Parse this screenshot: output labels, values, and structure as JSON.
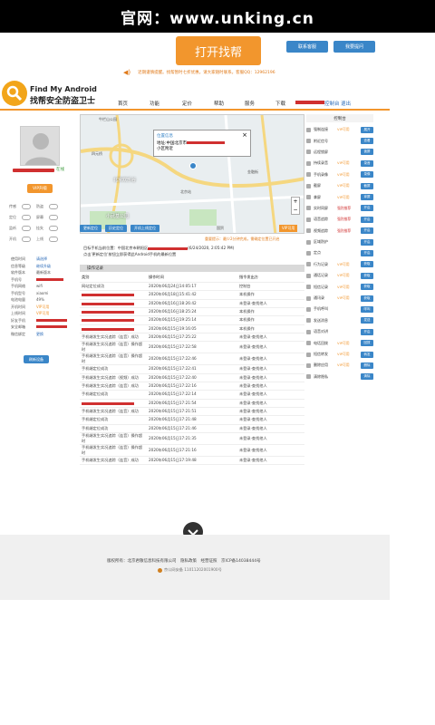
{
  "topbar": {
    "text": "官网：www.unking.cn"
  },
  "banner": {
    "open_label": "打开找帮",
    "cust_label": "联系客服",
    "ask_label": "我要提问",
    "notice": "近期谨慎提醒。找帮暂时七折优惠。请大家随时联系。客服QQ：12962196"
  },
  "brand": {
    "title_en": "Find My Android",
    "title_cn": "找帮安全防盗卫士"
  },
  "nav": {
    "items": [
      "首页",
      "功能",
      "定价",
      "帮助",
      "服务",
      "下载"
    ],
    "user_suffix": "控制台",
    "logout": "退出"
  },
  "user": {
    "status": "在线",
    "vip_label": "VIP升级"
  },
  "toggles": [
    {
      "a": "传感",
      "b": "防盗"
    },
    {
      "a": "定位",
      "b": "屏幕"
    },
    {
      "a": "监听",
      "b": "挂失"
    },
    {
      "a": "开机",
      "b": "上线"
    }
  ],
  "info": [
    {
      "k": "使用时间",
      "v": "请选择"
    },
    {
      "k": "信息等级",
      "v": "继续升级"
    },
    {
      "k": "软件版本",
      "v": "最新版本"
    },
    {
      "k": "手机号",
      "v": ""
    },
    {
      "k": "手机网络",
      "v": "wifi"
    },
    {
      "k": "手机型号",
      "v": "xiaomi"
    },
    {
      "k": "电池电量",
      "v": "49%"
    },
    {
      "k": "开机时间",
      "v": "VIP可用"
    },
    {
      "k": "上线时间",
      "v": "VIP可用"
    },
    {
      "k": "好友手机",
      "v": ""
    },
    {
      "k": "安全邮箱",
      "v": ""
    },
    {
      "k": "微信绑定",
      "v": "更换"
    }
  ],
  "detail_label": "刷新设备",
  "map": {
    "popup_title": "位置信息",
    "popup_addr": "地址:中国北京市",
    "popup_sub": "小区附近",
    "labels": [
      "牛栏山公园",
      "四元桥",
      "北京欢乐谷",
      "北京站",
      "小武基公园",
      "金融街",
      "国贸"
    ],
    "btns": [
      "更新定位",
      "历史定位",
      "开机上线定位"
    ],
    "vip_btn": "VIP可用",
    "tag": "重要提示：最少2分钟完成，需确定位置已开启",
    "loc_line1": "目标手机当前位置：中国北京市朝阳区",
    "loc_time": "(6/24/2020, 2:05:42 PM)",
    "loc_line2": "点击'更新定位'按钮立即获得此Android手机的最新位置"
  },
  "table": {
    "title": "操作记录",
    "headers": [
      "类别",
      "操作时间",
      "指令发出方"
    ],
    "rows": [
      [
        "网站定位成功",
        "2020年06月24日14:05:17",
        "控制台"
      ],
      [
        "",
        "2020年06月18日15:41:42",
        "本机操作"
      ],
      [
        "",
        "2020年06月16日18:26:42",
        "未登录·查找他人"
      ],
      [
        "",
        "2020年06月16日18:25:24",
        "本机操作"
      ],
      [
        "",
        "2020年06月15日19:25:14",
        "本机操作"
      ],
      [
        "",
        "2020年06月15日19:16:05",
        "本机操作"
      ],
      [
        "手机端发生实况追踪（连音）成功",
        "2020年06月15日17:25:22",
        "未登录·查找他人"
      ],
      [
        "手机端发生实况追踪（连音）操作超时",
        "2020年06月15日17:22:58",
        "未登录·查找他人"
      ],
      [
        "手机端发生实况追踪（连音）操作超时",
        "2020年06月15日17:22:46",
        "未登录·查找他人"
      ],
      [
        "手机端定位成功",
        "2020年06月15日17:22:41",
        "未登录·查找他人"
      ],
      [
        "手机端发生实况追踪（视频）成功",
        "2020年06月15日17:22:40",
        "未登录·查找他人"
      ],
      [
        "手机端发生实况追踪（连音）成功",
        "2020年06月15日17:22:16",
        "未登录·查找他人"
      ],
      [
        "手机端定位成功",
        "2020年06月15日17:22:14",
        "未登录·查找他人"
      ],
      [
        "",
        "2020年06月15日17:21:54",
        "未登录·查找他人"
      ],
      [
        "手机端发生实况追踪（连音）成功",
        "2020年06月15日17:21:51",
        "未登录·查找他人"
      ],
      [
        "手机端定位成功",
        "2020年06月15日17:21:48",
        "未登录·查找他人"
      ],
      [
        "手机端定位成功",
        "2020年06月15日17:21:46",
        "未登录·查找他人"
      ],
      [
        "手机端发生实况追踪（连音）操作超时",
        "2020年06月15日17:21:35",
        "未登录·查找他人"
      ],
      [
        "手机端发生实况追踪（连音）操作超时",
        "2020年06月15日17:21:16",
        "未登录·查找他人"
      ],
      [
        "手机端发生实况追踪（连音）成功",
        "2020年06月15日17:19:48",
        "未登录·查找他人"
      ]
    ]
  },
  "control": {
    "title": "控制台",
    "rows": [
      {
        "label": "强制连接",
        "status": "VIP可用",
        "go": "展开"
      },
      {
        "label": "附近信号",
        "status": "",
        "go": "查看"
      },
      {
        "label": "远程锁屏",
        "status": "",
        "go": "锁屏"
      },
      {
        "label": "持续录音",
        "status": "VIP可用",
        "go": "录音"
      },
      {
        "label": "手机录像",
        "status": "VIP可用",
        "go": "录像"
      },
      {
        "label": "截屏",
        "status": "VIP可用",
        "go": "截屏"
      },
      {
        "label": "拿屏",
        "status": "VIP可用",
        "go": "拿屏"
      },
      {
        "label": "实时同屏",
        "status": "强烈推荐",
        "go": "开启"
      },
      {
        "label": "语音追踪",
        "status": "强烈推荐",
        "go": "开启"
      },
      {
        "label": "视频追踪",
        "status": "强烈推荐",
        "go": "开启"
      },
      {
        "label": "区域防护",
        "status": "",
        "go": "开启"
      },
      {
        "label": "定点",
        "status": "",
        "go": "开启"
      },
      {
        "label": "行为记录",
        "status": "VIP可用",
        "go": "获取"
      },
      {
        "label": "通话记录",
        "status": "VIP可用",
        "go": "获取"
      },
      {
        "label": "短信记录",
        "status": "VIP可用",
        "go": "获取"
      },
      {
        "label": "通讯录",
        "status": "VIP可用",
        "go": "获取"
      },
      {
        "label": "手机呼叫",
        "status": "",
        "go": "呼叫"
      },
      {
        "label": "发送消息",
        "status": "",
        "go": "发送"
      },
      {
        "label": "语音对讲",
        "status": "",
        "go": "开启"
      },
      {
        "label": "电话回拨",
        "status": "VIP可用",
        "go": "回拨"
      },
      {
        "label": "短信转发",
        "status": "VIP可用",
        "go": "转发"
      },
      {
        "label": "删除应用",
        "status": "VIP可用",
        "go": "删除"
      },
      {
        "label": "清除隐私",
        "status": "",
        "go": "清除"
      }
    ]
  },
  "footer": {
    "line1": "版权所有：北京君敬信息科技有限公司　隐私政策　经营证照　京ICP备14038444号",
    "line2": "京公网安备 11011202001900号"
  },
  "colors": {
    "accent": "#f2962d",
    "blue": "#3a86c8",
    "red": "#d03030"
  }
}
